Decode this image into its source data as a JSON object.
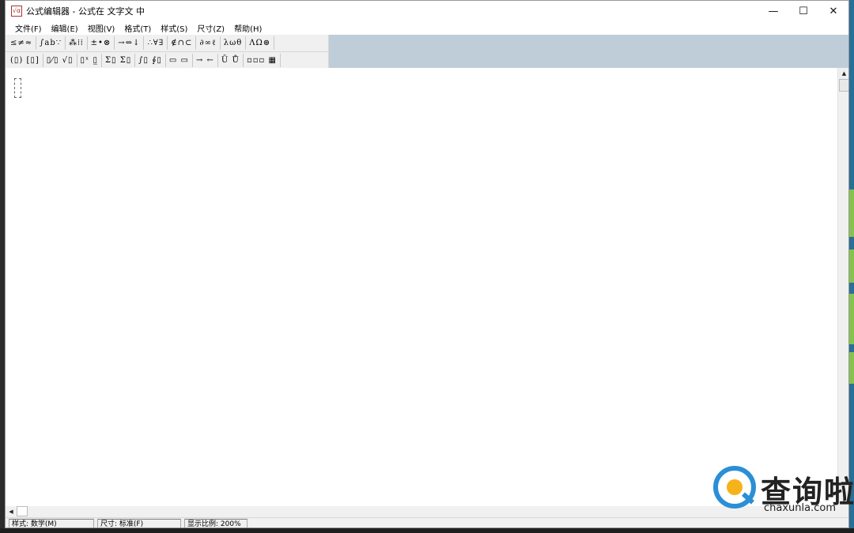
{
  "window": {
    "app_icon": "equation-editor-icon",
    "app_icon_text": "√α",
    "title": "公式编辑器 - 公式在 文字文 中",
    "minimize": "—",
    "maximize": "☐",
    "close": "✕"
  },
  "menu": [
    {
      "label": "文件(F)"
    },
    {
      "label": "编辑(E)"
    },
    {
      "label": "视图(V)"
    },
    {
      "label": "格式(T)"
    },
    {
      "label": "样式(S)"
    },
    {
      "label": "尺寸(Z)"
    },
    {
      "label": "帮助(H)"
    }
  ],
  "palette_row1": [
    {
      "label": "≤≠≈"
    },
    {
      "label": "∫ab∵"
    },
    {
      "label": "⁂⁞⁞"
    },
    {
      "label": "±•⊗"
    },
    {
      "label": "→⇔↓"
    },
    {
      "label": "∴∀∃"
    },
    {
      "label": "∉∩⊂"
    },
    {
      "label": "∂∞ℓ"
    },
    {
      "label": "λωθ"
    },
    {
      "label": "ΛΩ⊛"
    }
  ],
  "palette_row2": [
    {
      "label": "(▯) [▯]"
    },
    {
      "label": "▯⁄▯ √▯"
    },
    {
      "label": "▯ˣ ▯̲"
    },
    {
      "label": "Σ▯ Σ▯"
    },
    {
      "label": "∫▯ ∮▯"
    },
    {
      "label": "▭ ▭"
    },
    {
      "label": "→ ←"
    },
    {
      "label": "Ū Ů"
    },
    {
      "label": "▫▫▫ ▦"
    }
  ],
  "scroll": {
    "up": "▲",
    "left": "◀"
  },
  "status": {
    "style": "样式: 数学(M)",
    "size": "尺寸: 标准(F)",
    "zoom": "显示比例: 200%"
  },
  "watermark": {
    "cn": "查询啦",
    "en": "chaxunla.com"
  }
}
